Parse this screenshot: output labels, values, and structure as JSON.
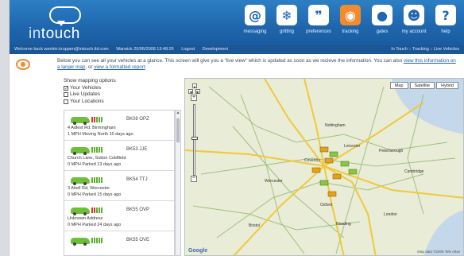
{
  "brand": {
    "word_a": "in",
    "word_b": "touch"
  },
  "nav": [
    {
      "label": "messaging",
      "icon": "at-icon",
      "glyph": "@"
    },
    {
      "label": "gritting",
      "icon": "snowflake-icon",
      "glyph": "❄"
    },
    {
      "label": "preferences",
      "icon": "quote-icon",
      "glyph": "❞"
    },
    {
      "label": "tracking",
      "icon": "eye-icon",
      "glyph": "◉",
      "active": true
    },
    {
      "label": "gates",
      "icon": "drop-icon",
      "glyph": "●"
    },
    {
      "label": "my account",
      "icon": "user-icon",
      "glyph": "☻"
    },
    {
      "label": "help",
      "icon": "question-icon",
      "glyph": "?"
    }
  ],
  "infobar": {
    "welcome": "Welcome back wenkin.kruppen@intouch.ltd.com",
    "datetime": "Warwick 20/06/2008 13:48:26",
    "logout": "Logout",
    "development": "Development",
    "breadcrumb": "In Touch :: Tracking :: Live Vehicles"
  },
  "intro": {
    "text": "Below you can see all your vehicles at a glance. This screen will give you a \"live view\" which is updated as soon as we recieve the information. You can also",
    "link1": "view this information on a larger map",
    "mid": ", or",
    "link2": "view a formatted report",
    "end": "."
  },
  "options": {
    "title": "Show mapping options",
    "items": [
      {
        "label": "Your Vehicles",
        "checked": true
      },
      {
        "label": "Live Updates",
        "checked": false
      },
      {
        "label": "Your Locations",
        "checked": false
      }
    ]
  },
  "vehicles": [
    {
      "reg": "BK08 OPZ",
      "line1": "4 Adlest Rd, Birmingham",
      "line2": "1 MPH Moving North 10 days ago",
      "bars": "mixed"
    },
    {
      "reg": "BK53 JJE",
      "line1": "Church Lane, Sutton Coldfield",
      "line2": "0 MPH Parked 13 days ago",
      "bars": "green"
    },
    {
      "reg": "BK54 TTJ",
      "line1": "3 Abell Rd, Worcester",
      "line2": "0 MPH Parked 15 days ago",
      "bars": "green"
    },
    {
      "reg": "BK55 OVP",
      "line1": "Unknown Address",
      "line2": "0 MPH Parked 24 days ago",
      "bars": "mixed"
    },
    {
      "reg": "BK55 OVE",
      "line1": "",
      "line2": "",
      "bars": "green"
    }
  ],
  "map": {
    "type_buttons": [
      "Map",
      "Satellite",
      "Hybrid"
    ],
    "provider": "Google",
    "copyright": "Map data ©2008 Tele Atlas",
    "towns": [
      "Nottingham",
      "Leicester",
      "Coventry",
      "Worcester",
      "Oxford",
      "Reading",
      "London",
      "Peterborough",
      "Cambridge",
      "Bristol"
    ]
  },
  "colors": {
    "header": "#1f66ad",
    "accent": "#f28a2e",
    "map_land": "#e9ecd7",
    "roads": "#f7d94a"
  }
}
